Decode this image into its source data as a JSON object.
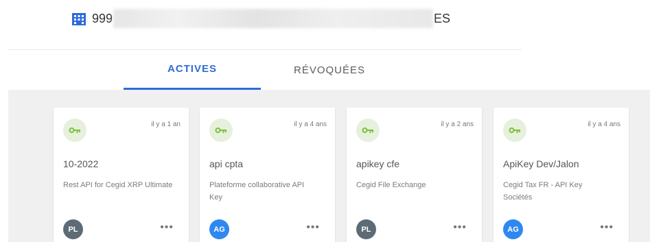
{
  "organization": {
    "name_start": "999",
    "name_end": "ES",
    "icon": "building-icon",
    "icon_color": "#2f6bd8"
  },
  "tabs": {
    "active_label": "ACTIVES",
    "revoked_label": "RÉVOQUÉES",
    "accent_color": "#2f6bd8"
  },
  "cards": [
    {
      "age": "il y a 1 an",
      "title": "10-2022",
      "description": "Rest API for Cegid XRP Ultimate",
      "avatar": "PL",
      "avatar_color": "#5c6b75",
      "more": "•••"
    },
    {
      "age": "il y a 4 ans",
      "title": "api cpta",
      "description": "Plateforme collaborative API Key",
      "avatar": "AG",
      "avatar_color": "#2f88f0",
      "more": "•••"
    },
    {
      "age": "il y a 2 ans",
      "title": "apikey cfe",
      "description": "Cegid File Exchange",
      "avatar": "PL",
      "avatar_color": "#5c6b75",
      "more": "•••"
    },
    {
      "age": "il y a 4 ans",
      "title": "ApiKey Dev/Jalon",
      "description": "Cegid Tax FR - API Key Sociétés",
      "avatar": "AG",
      "avatar_color": "#2f88f0",
      "more": "•••"
    }
  ],
  "key_icon_color": "#7cbf3a",
  "key_icon_bg": "#e6f0dc"
}
